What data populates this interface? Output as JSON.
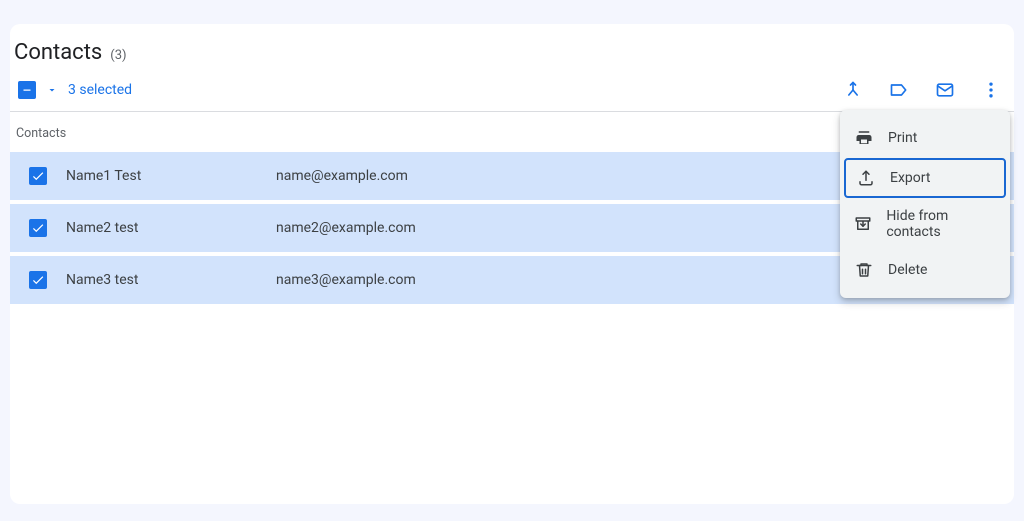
{
  "header": {
    "title": "Contacts",
    "count_label": "(3)"
  },
  "toolbar": {
    "selected_text": "3 selected"
  },
  "section": {
    "label": "Contacts"
  },
  "rows": [
    {
      "name": "Name1 Test",
      "email": "name@example.com"
    },
    {
      "name": "Name2 test",
      "email": "name2@example.com"
    },
    {
      "name": "Name3 test",
      "email": "name3@example.com"
    }
  ],
  "menu": {
    "print": "Print",
    "export": "Export",
    "hide": "Hide from contacts",
    "delete": "Delete"
  }
}
